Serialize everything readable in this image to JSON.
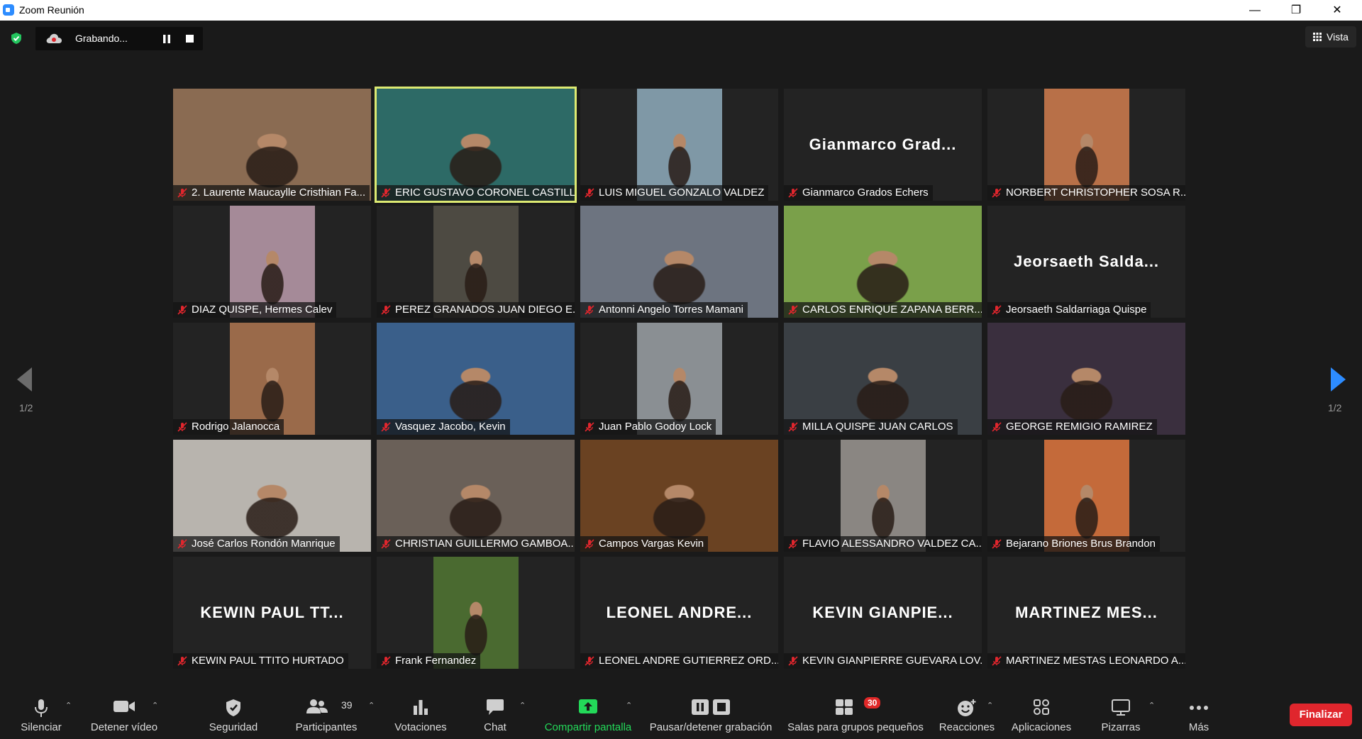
{
  "window": {
    "title": "Zoom Reunión"
  },
  "recording": {
    "label": "Grabando..."
  },
  "view_button": {
    "label": "Vista"
  },
  "pagination": {
    "left": "1/2",
    "right": "1/2"
  },
  "tiles": [
    {
      "name": "2. Laurente Maucaylle Cristhian Fa...",
      "big": "",
      "video": true,
      "color": "#8a6b52"
    },
    {
      "name": "ERIC GUSTAVO CORONEL CASTILLO",
      "big": "",
      "video": true,
      "color": "#2d6a66",
      "active": true
    },
    {
      "name": "LUIS MIGUEL GONZALO VALDEZ",
      "big": "",
      "video": "small",
      "color": "#7f98a6"
    },
    {
      "name": "Gianmarco Grados Echers",
      "big": "Gianmarco Grad...",
      "video": false
    },
    {
      "name": "NORBERT CHRISTOPHER SOSA R...",
      "big": "",
      "video": "small",
      "color": "#b87048"
    },
    {
      "name": "DIAZ QUISPE, Hermes Calev",
      "big": "",
      "video": "small",
      "color": "#a58a98"
    },
    {
      "name": "PEREZ GRANADOS JUAN DIEGO E...",
      "big": "",
      "video": "small",
      "color": "#4d4a42"
    },
    {
      "name": "Antonni Angelo Torres Mamani",
      "big": "",
      "video": true,
      "color": "#6d7480"
    },
    {
      "name": "CARLOS ENRIQUE ZAPANA BERR...",
      "big": "",
      "video": true,
      "color": "#7aa04a"
    },
    {
      "name": "Jeorsaeth Saldarriaga Quispe",
      "big": "Jeorsaeth Salda...",
      "video": false
    },
    {
      "name": "Rodrigo Jalanocca",
      "big": "",
      "video": "small",
      "color": "#9a6a4a"
    },
    {
      "name": "Vasquez Jacobo, Kevin",
      "big": "",
      "video": true,
      "color": "#3a5f8a"
    },
    {
      "name": "Juan Pablo Godoy Lock",
      "big": "",
      "video": "small",
      "color": "#8a8f93"
    },
    {
      "name": "MILLA QUISPE JUAN CARLOS",
      "big": "",
      "video": true,
      "color": "#3a3f44"
    },
    {
      "name": "GEORGE REMIGIO RAMIREZ",
      "big": "",
      "video": true,
      "color": "#3a2f3e"
    },
    {
      "name": "José Carlos Rondón Manrique",
      "big": "",
      "video": true,
      "color": "#b8b4ae"
    },
    {
      "name": "CHRISTIAN GUILLERMO GAMBOA...",
      "big": "",
      "video": true,
      "color": "#6a6058"
    },
    {
      "name": "Campos Vargas Kevin",
      "big": "",
      "video": true,
      "color": "#6a4222"
    },
    {
      "name": "FLAVIO ALESSANDRO VALDEZ CA...",
      "big": "",
      "video": "small",
      "color": "#8a8682"
    },
    {
      "name": "Bejarano Briones Brus Brandon",
      "big": "",
      "video": "small",
      "color": "#c46a3a"
    },
    {
      "name": "KEWIN PAUL TTITO HURTADO",
      "big": "KEWIN PAUL TT...",
      "video": false
    },
    {
      "name": "Frank Fernandez",
      "big": "",
      "video": "small",
      "color": "#4a6a30"
    },
    {
      "name": "LEONEL ANDRE GUTIERREZ ORD...",
      "big": "LEONEL ANDRE...",
      "video": false
    },
    {
      "name": "KEVIN GIANPIERRE GUEVARA LOV...",
      "big": "KEVIN GIANPIE...",
      "video": false
    },
    {
      "name": "MARTINEZ MESTAS LEONARDO A...",
      "big": "MARTINEZ MES...",
      "video": false
    }
  ],
  "toolbar": {
    "mute": "Silenciar",
    "video": "Detener vídeo",
    "security": "Seguridad",
    "participants": "Participantes",
    "participants_count": "39",
    "polls": "Votaciones",
    "chat": "Chat",
    "share": "Compartir pantalla",
    "record": "Pausar/detener grabación",
    "breakout": "Salas para grupos pequeños",
    "breakout_badge": "30",
    "reactions": "Reacciones",
    "apps": "Aplicaciones",
    "whiteboards": "Pizarras",
    "more": "Más",
    "end": "Finalizar"
  },
  "colors": {
    "accent": "#2d8cff",
    "share_green": "#23d959",
    "end_red": "#e0262d",
    "active_speaker": "#ddea72"
  }
}
